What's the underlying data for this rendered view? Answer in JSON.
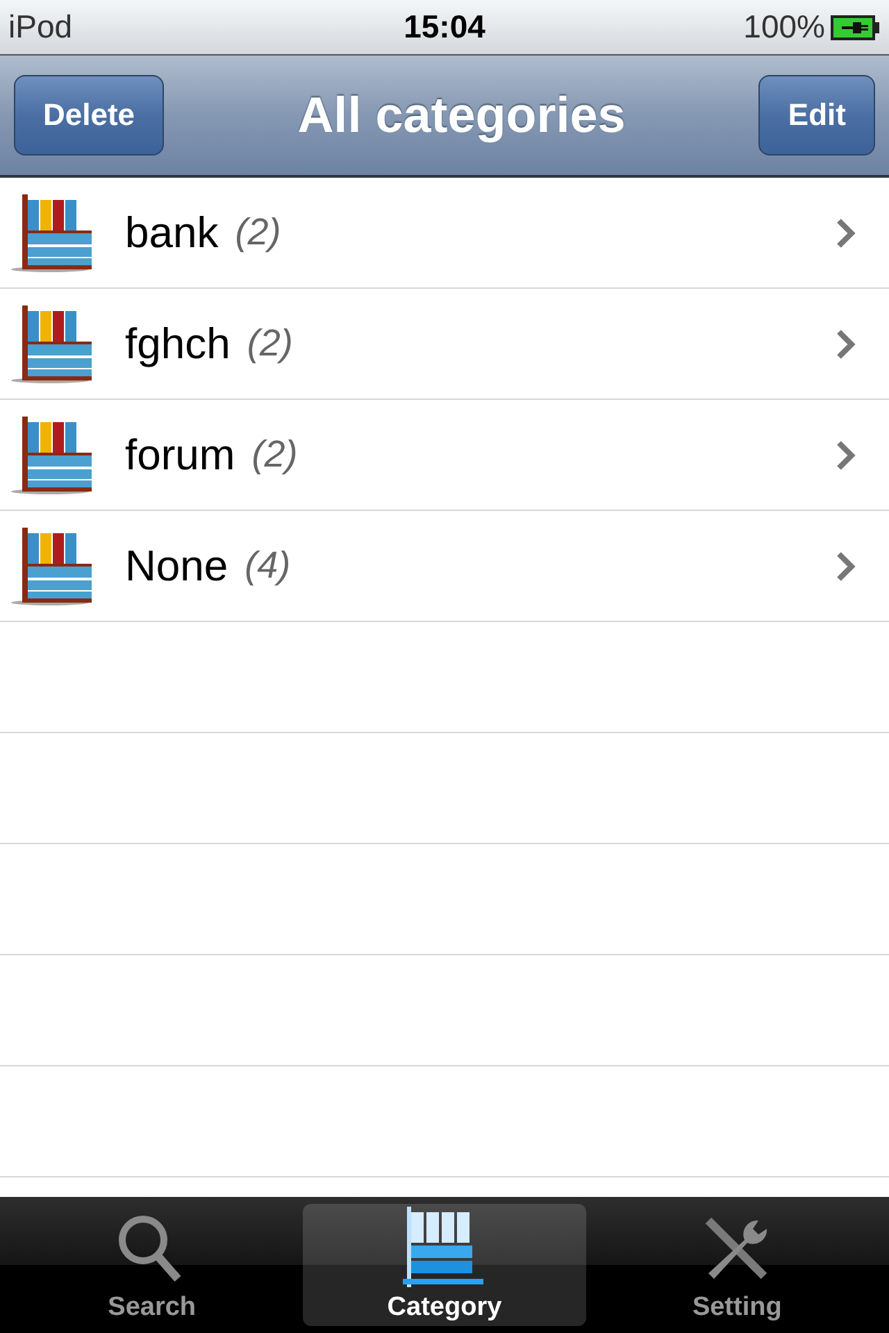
{
  "status_bar": {
    "device": "iPod",
    "time": "15:04",
    "battery": "100%"
  },
  "nav_bar": {
    "title": "All categories",
    "left_button": "Delete",
    "right_button": "Edit"
  },
  "categories": [
    {
      "name": "bank",
      "count": "(2)"
    },
    {
      "name": "fghch",
      "count": "(2)"
    },
    {
      "name": "forum",
      "count": "(2)"
    },
    {
      "name": "None",
      "count": "(4)"
    }
  ],
  "tab_bar": [
    {
      "label": "Search",
      "kind": "search",
      "selected": false
    },
    {
      "label": "Category",
      "kind": "category",
      "selected": true
    },
    {
      "label": "Setting",
      "kind": "setting",
      "selected": false
    }
  ]
}
